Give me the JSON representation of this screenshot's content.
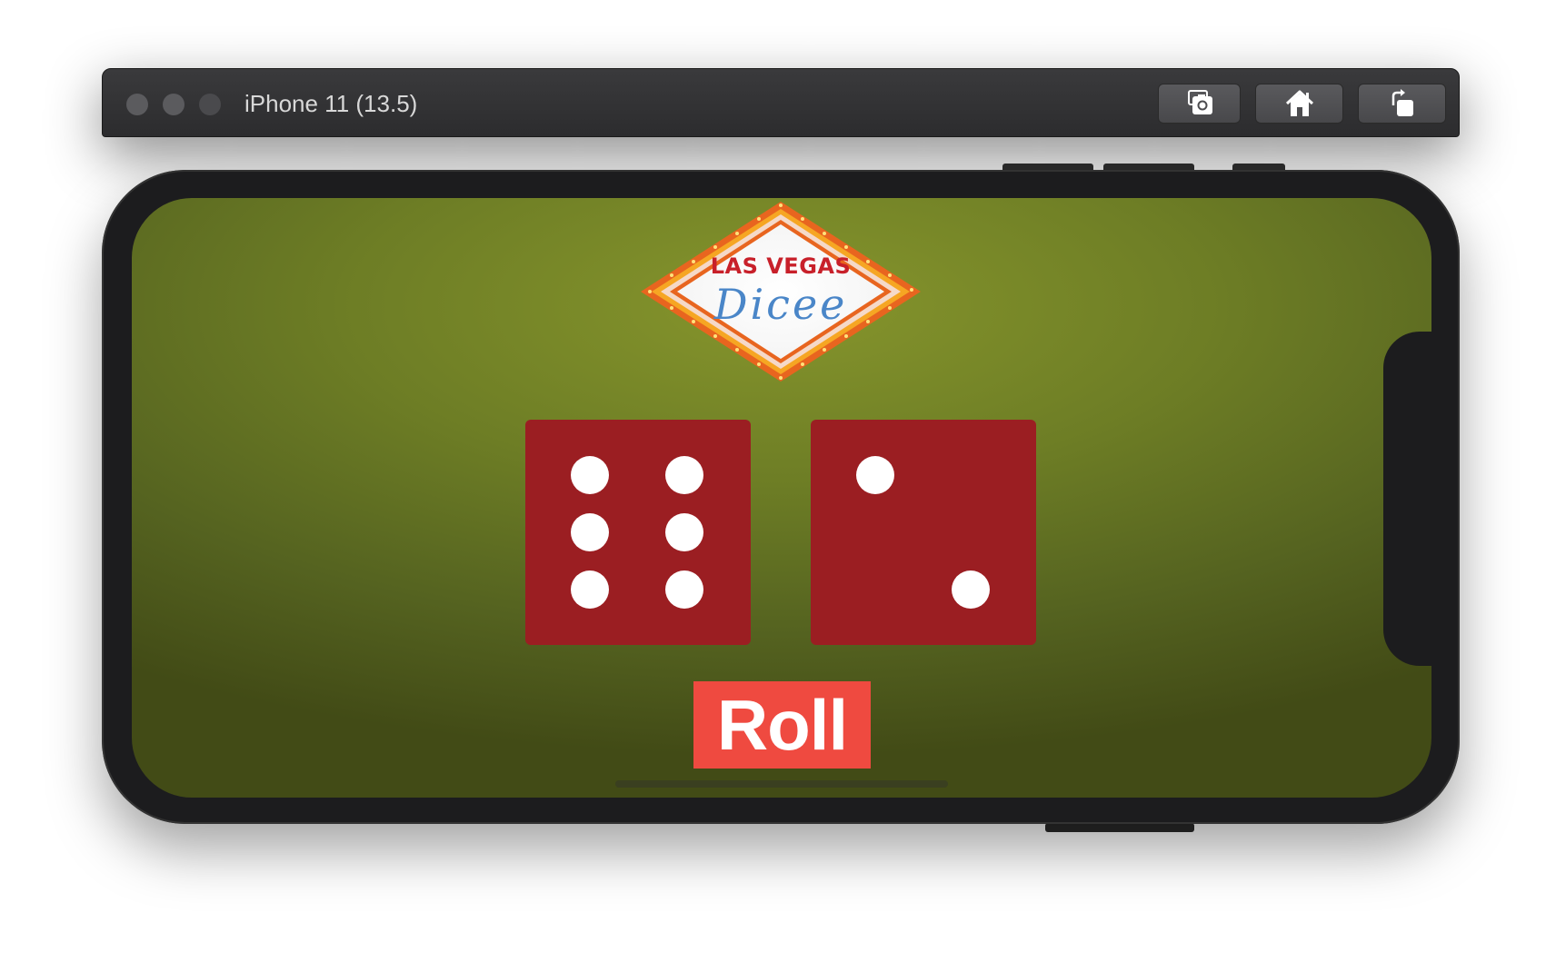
{
  "window": {
    "title": "iPhone 11 (13.5)",
    "toolbar": {
      "screenshot_icon": "camera-icon",
      "home_icon": "house-icon",
      "rotate_icon": "rotate-icon"
    }
  },
  "app": {
    "logo": {
      "title": "LAS VEGAS",
      "subtitle": "Dicee"
    },
    "dice": [
      {
        "value": 6
      },
      {
        "value": 2
      }
    ],
    "roll_label": "Roll"
  },
  "colors": {
    "felt": "#6d7d25",
    "die": "#9b1e22",
    "pip": "#ffffff",
    "button": "#ef4a40",
    "logo_red": "#c8202a",
    "logo_blue": "#4a86c8"
  }
}
